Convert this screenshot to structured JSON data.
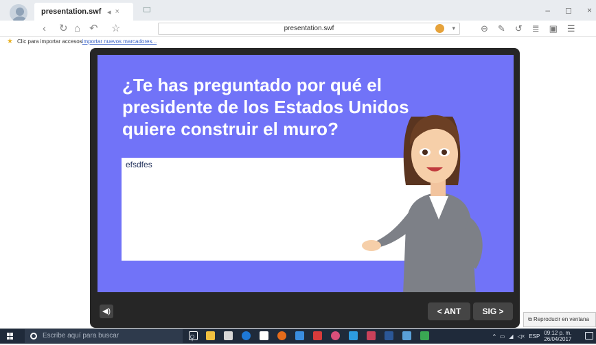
{
  "browser": {
    "tab_title": "presentation.swf",
    "tab_speaker": "◂",
    "tab_close": "×",
    "url": "presentation.swf",
    "bookmark_hint": "Clic para importar accesos",
    "bookmark_link": "importar nuevos marcadores...",
    "minimize": "–",
    "maximize": "◻",
    "close": "×"
  },
  "slide": {
    "question": "¿Te has preguntado por qué el presidente de los Estados Unidos quiere construir el muro?",
    "answer": "efsdfes",
    "background_color": "#7173f8"
  },
  "controls": {
    "speaker_icon": "speaker-icon",
    "prev_label": "< ANT",
    "next_label": "SIG >"
  },
  "popout": {
    "label": "Reproducir en ventana"
  },
  "taskbar": {
    "search_placeholder": "Escribe aquí para buscar",
    "language": "ESP",
    "time": "09:12 p. m.",
    "date": "26/04/2017"
  }
}
